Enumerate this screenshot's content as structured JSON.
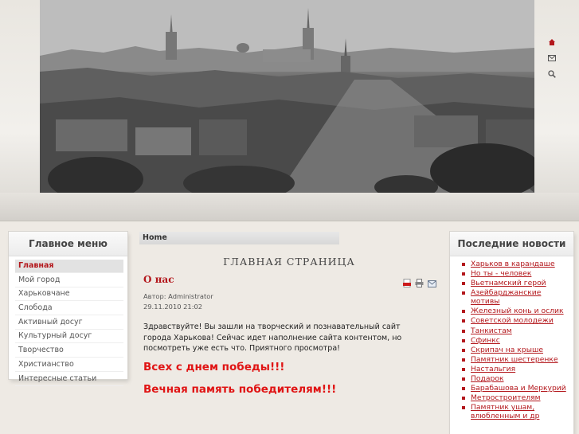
{
  "header": {
    "icons": [
      "home-icon",
      "mail-icon",
      "search-icon"
    ]
  },
  "left_menu": {
    "title": "Главное меню",
    "items": [
      {
        "label": "Главная",
        "active": true
      },
      {
        "label": "Мой город",
        "active": false
      },
      {
        "label": "Харьковчане",
        "active": false
      },
      {
        "label": "Слобода",
        "active": false
      },
      {
        "label": "Активный досуг",
        "active": false
      },
      {
        "label": "Культурный досуг",
        "active": false
      },
      {
        "label": "Творчество",
        "active": false
      },
      {
        "label": "Христианство",
        "active": false
      },
      {
        "label": "Интересные статьи",
        "active": false
      }
    ]
  },
  "breadcrumb": "Home",
  "main": {
    "heading": "ГЛАВНАЯ СТРАНИЦА",
    "article_title": "О нас",
    "author": "Автор: Administrator",
    "date": "29.11.2010 21:02",
    "intro": "Здравствуйте! Вы зашли на творческий и познавательный сайт города Харькова! Сейчас идет наполнение сайта контентом, но посмотреть уже есть что. Приятного просмотра!",
    "greeting1": "Всех с днем победы!!!",
    "greeting2": "Вечная память победителям!!!",
    "tool_icons": [
      "pdf-icon",
      "print-icon",
      "email-icon"
    ]
  },
  "news": {
    "title": "Последние новости",
    "items": [
      "Харьков в карандаше",
      "Но ты - человек",
      "Вьетнамский герой",
      "Азейбарджанские мотивы",
      "Железный конь и ослик",
      "Советской молодежи",
      "Танкистам",
      "Сфинкс",
      "Скрипач на крыше",
      "Памятник шестеренке",
      "Настальгия",
      "Подарок",
      "Барабашова и Меркурий",
      "Метростроителям",
      "Памятник ушам, влюбленным и др"
    ]
  },
  "colors": {
    "accent": "#b3171c",
    "alert": "#e01414"
  }
}
